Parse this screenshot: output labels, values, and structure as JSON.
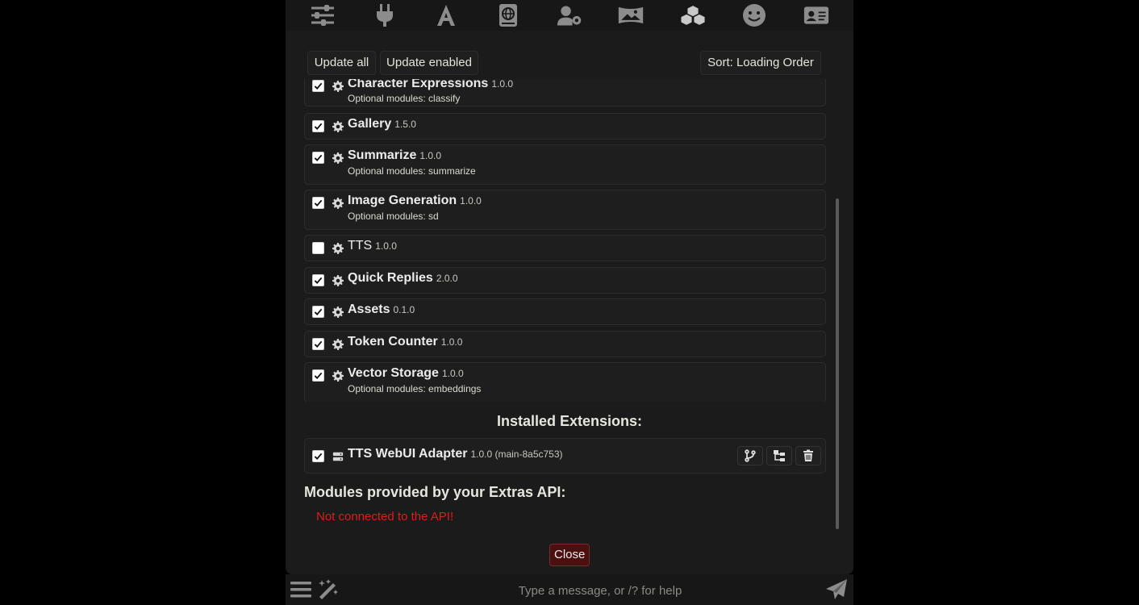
{
  "top_nav": {
    "icons": [
      "sliders-icon",
      "plug-icon",
      "font-icon",
      "book-atlas-icon",
      "user-gear-icon",
      "panorama-icon",
      "cubes-icon",
      "face-smile-icon",
      "address-card-icon"
    ],
    "active": "cubes-icon"
  },
  "toolbar": {
    "update_all_label": "Update all",
    "update_enabled_label": "Update enabled",
    "sort_label": "Sort: Loading Order"
  },
  "extensions": [
    {
      "name": "Character Expressions",
      "version": "1.0.0",
      "enabled": true,
      "optional": "Optional modules: classify"
    },
    {
      "name": "Gallery",
      "version": "1.5.0",
      "enabled": true,
      "optional": ""
    },
    {
      "name": "Summarize",
      "version": "1.0.0",
      "enabled": true,
      "optional": "Optional modules: summarize"
    },
    {
      "name": "Image Generation",
      "version": "1.0.0",
      "enabled": true,
      "optional": "Optional modules: sd"
    },
    {
      "name": "TTS",
      "version": "1.0.0",
      "enabled": false,
      "optional": ""
    },
    {
      "name": "Quick Replies",
      "version": "2.0.0",
      "enabled": true,
      "optional": ""
    },
    {
      "name": "Assets",
      "version": "0.1.0",
      "enabled": true,
      "optional": ""
    },
    {
      "name": "Token Counter",
      "version": "1.0.0",
      "enabled": true,
      "optional": ""
    },
    {
      "name": "Vector Storage",
      "version": "1.0.0",
      "enabled": true,
      "optional": "Optional modules: embeddings"
    }
  ],
  "installed": {
    "title": "Installed Extensions:",
    "items": [
      {
        "name": "TTS WebUI Adapter",
        "version": "1.0.0 (main-8a5c753)",
        "enabled": true
      }
    ]
  },
  "extras": {
    "title": "Modules provided by your Extras API:",
    "status": "Not connected to the API!",
    "status_color": "#e21b1b"
  },
  "close_label": "Close",
  "chat": {
    "placeholder": "Type a message, or /? for help"
  }
}
